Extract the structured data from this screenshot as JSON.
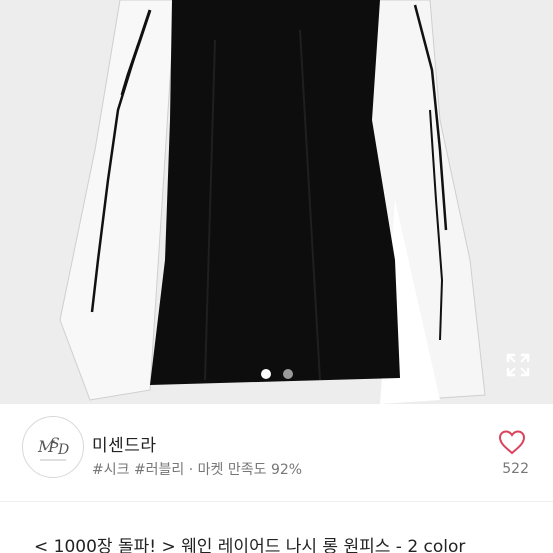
{
  "product": {
    "image_carousel": {
      "total": 2,
      "current": 1,
      "active_color": "#ffffff",
      "inactive_color": "#9a9a9a"
    },
    "title": "< 1000장 돌파! >  웨인 레이어드 나시 롱 원피스 - 2 color"
  },
  "seller": {
    "name": "미센드라",
    "tags": "#시크 #러블리 · 마켓 만족도 92%",
    "logo_text": "MSD",
    "likes": "522"
  },
  "icons": {
    "expand": "expand-icon",
    "like": "heart-outline-icon"
  },
  "colors": {
    "heart": "#d9435d",
    "dress_black": "#0d0d0d",
    "layer_white": "#f7f7f7"
  }
}
